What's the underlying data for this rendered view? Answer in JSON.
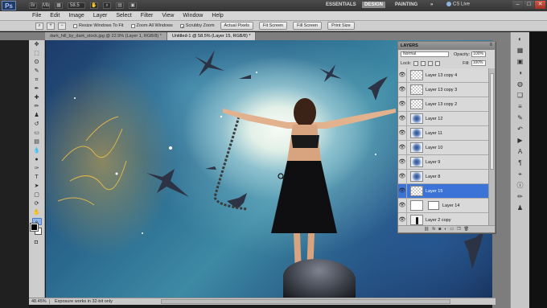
{
  "app": {
    "logo": "Ps",
    "zoom_value": "58.5",
    "workspaces": [
      "ESSENTIALS",
      "DESIGN",
      "PAINTING"
    ],
    "active_workspace": "DESIGN",
    "cs_live": "CS Live"
  },
  "menu": [
    "File",
    "Edit",
    "Image",
    "Layer",
    "Select",
    "Filter",
    "View",
    "Window",
    "Help"
  ],
  "options": {
    "resize_windows": "Resize Windows To Fit",
    "zoom_all_windows": "Zoom All Windows",
    "scrubby_zoom": "Scrubby Zoom",
    "actual_pixels": "Actual Pixels",
    "fit_screen": "Fit Screen",
    "fill_screen": "Fill Screen",
    "print_size": "Print Size"
  },
  "tabs": [
    "dark_hill_by_dark_stock.jpg @ 22.9% (Layer 1, RGB/8) *",
    "Untitled-1 @ 58.5% (Layer 15, RGB/8) *"
  ],
  "layers_panel": {
    "title": "LAYERS",
    "blend_mode": "Normal",
    "opacity_label": "Opacity:",
    "opacity": "100%",
    "lock_label": "Lock:",
    "fill_label": "Fill:",
    "fill": "100%",
    "layers": [
      {
        "name": "Layer 13 copy 4",
        "thumb": "checker"
      },
      {
        "name": "Layer 13 copy 3",
        "thumb": "checker"
      },
      {
        "name": "Layer 13 copy 2",
        "thumb": "checker"
      },
      {
        "name": "Layer 12",
        "thumb": "bird"
      },
      {
        "name": "Layer 11",
        "thumb": "bird"
      },
      {
        "name": "Layer 10",
        "thumb": "bird"
      },
      {
        "name": "Layer 9",
        "thumb": "bird"
      },
      {
        "name": "Layer 8",
        "thumb": "bird"
      },
      {
        "name": "Layer 15",
        "thumb": "checker",
        "selected": true
      },
      {
        "name": "Layer 14",
        "thumb": "white",
        "mask": true
      },
      {
        "name": "Layer 2 copy",
        "thumb": "fig"
      }
    ]
  },
  "status": {
    "zoom": "48.45%",
    "message": "Exposure works in 32-bit only"
  }
}
